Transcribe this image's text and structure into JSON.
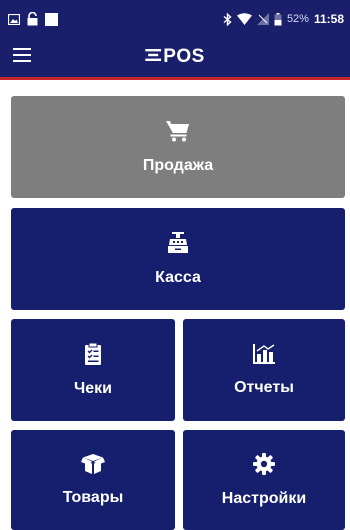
{
  "status_bar": {
    "battery_percent": "52%",
    "time": "11:58",
    "icons": [
      "image-icon",
      "lock-icon",
      "white-square-icon",
      "bluetooth-icon",
      "wifi-icon",
      "no-signal-icon",
      "battery-icon"
    ]
  },
  "app_bar": {
    "logo": "POS",
    "icons": [
      "hamburger-menu-icon",
      "epos-logo-icon"
    ],
    "colors": {
      "bar": "#1a1f6b",
      "accent_line": "#c9232d"
    }
  },
  "tiles": {
    "sale": {
      "label": "Продажа",
      "icon": "shopping-cart-icon",
      "color": "#7e7e7e"
    },
    "cash": {
      "label": "Касса",
      "icon": "cash-register-icon",
      "color": "#151f6e"
    },
    "receipts": {
      "label": "Чеки",
      "icon": "clipboard-checklist-icon",
      "color": "#151f6e"
    },
    "reports": {
      "label": "Отчеты",
      "icon": "bar-chart-icon",
      "color": "#151f6e"
    },
    "goods": {
      "label": "Товары",
      "icon": "box-icon",
      "color": "#151f6e"
    },
    "settings": {
      "label": "Настройки",
      "icon": "gear-icon",
      "color": "#151f6e"
    }
  }
}
